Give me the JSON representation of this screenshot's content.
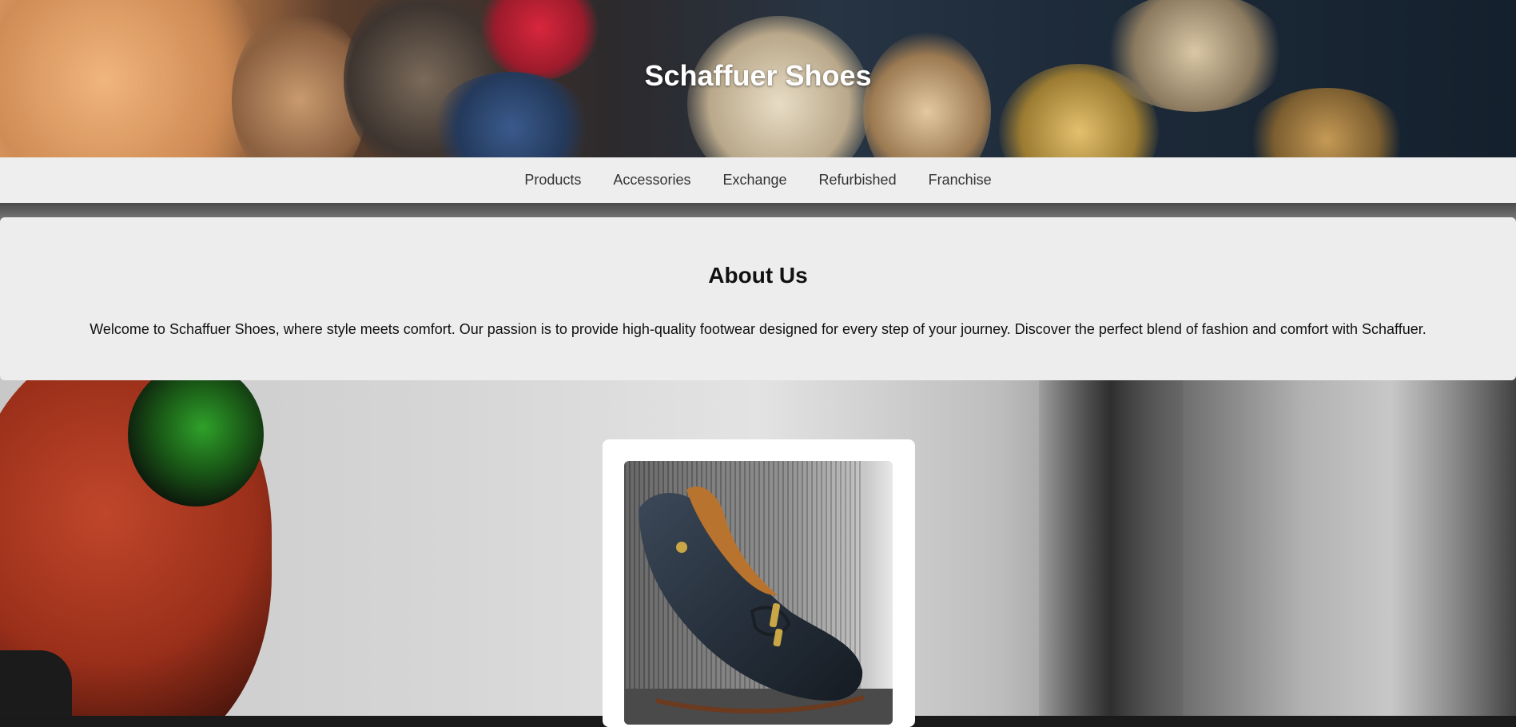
{
  "header": {
    "title": "Schaffuer Shoes"
  },
  "nav": {
    "items": [
      {
        "label": "Products"
      },
      {
        "label": "Accessories"
      },
      {
        "label": "Exchange"
      },
      {
        "label": "Refurbished"
      },
      {
        "label": "Franchise"
      }
    ]
  },
  "about": {
    "heading": "About Us",
    "body": "Welcome to Schaffuer Shoes, where style meets comfort. Our passion is to provide high-quality footwear designed for every step of your journey. Discover the perfect blend of fashion and comfort with Schaffuer."
  },
  "colors": {
    "nav_background": "#eeeeee",
    "about_background": "#ededed",
    "card_background": "#ffffff",
    "title_text": "#ffffff"
  }
}
